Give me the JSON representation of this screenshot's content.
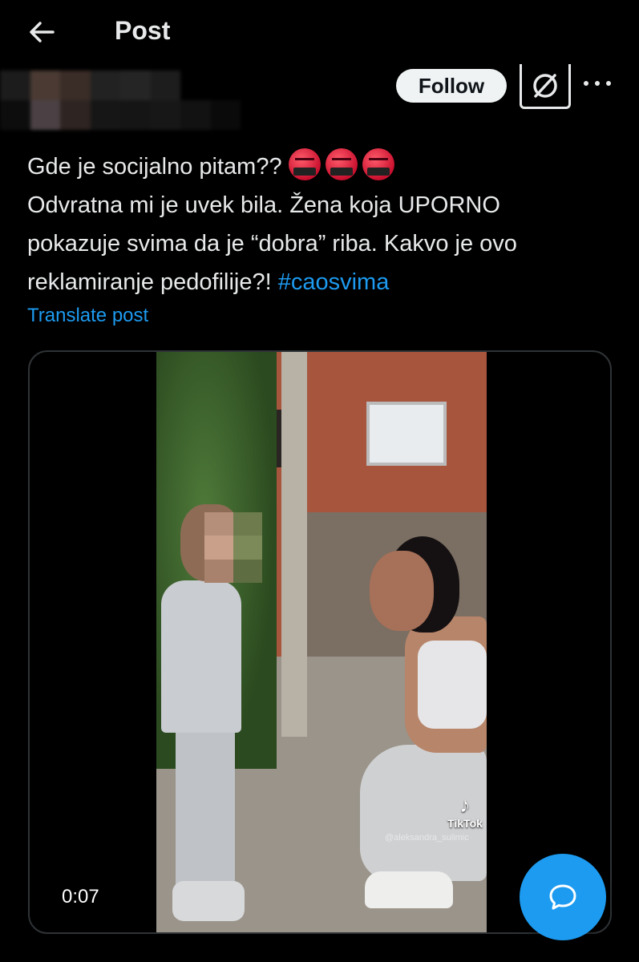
{
  "header": {
    "title": "Post",
    "back_icon": "arrow-left-icon"
  },
  "author": {
    "follow_label": "Follow",
    "grok_icon": "grok-icon",
    "more_icon": "more-dots-icon"
  },
  "post": {
    "line1": "Gde je socijalno pitam??",
    "emoji_icon": "angry-cursing-face-emoji",
    "emoji_count": 3,
    "line2": "Odvratna mi je uvek bila. Žena koja UPORNO",
    "line3": "pokazuje svima da je “dobra” riba. Kakvo je ovo",
    "line4_text": "reklamiranje pedofilije?! ",
    "hashtag": "#caosvima",
    "translate_label": "Translate post"
  },
  "media": {
    "timestamp": "0:07",
    "watermark_brand": "TikTok",
    "watermark_user": "@aleksandra_sulimic"
  },
  "fab": {
    "icon": "compose-reply-icon"
  },
  "colors": {
    "background": "#000000",
    "text": "#e7e9ea",
    "accent": "#1d9bf0",
    "follow_bg": "#eff3f4",
    "border": "#2f3336"
  }
}
